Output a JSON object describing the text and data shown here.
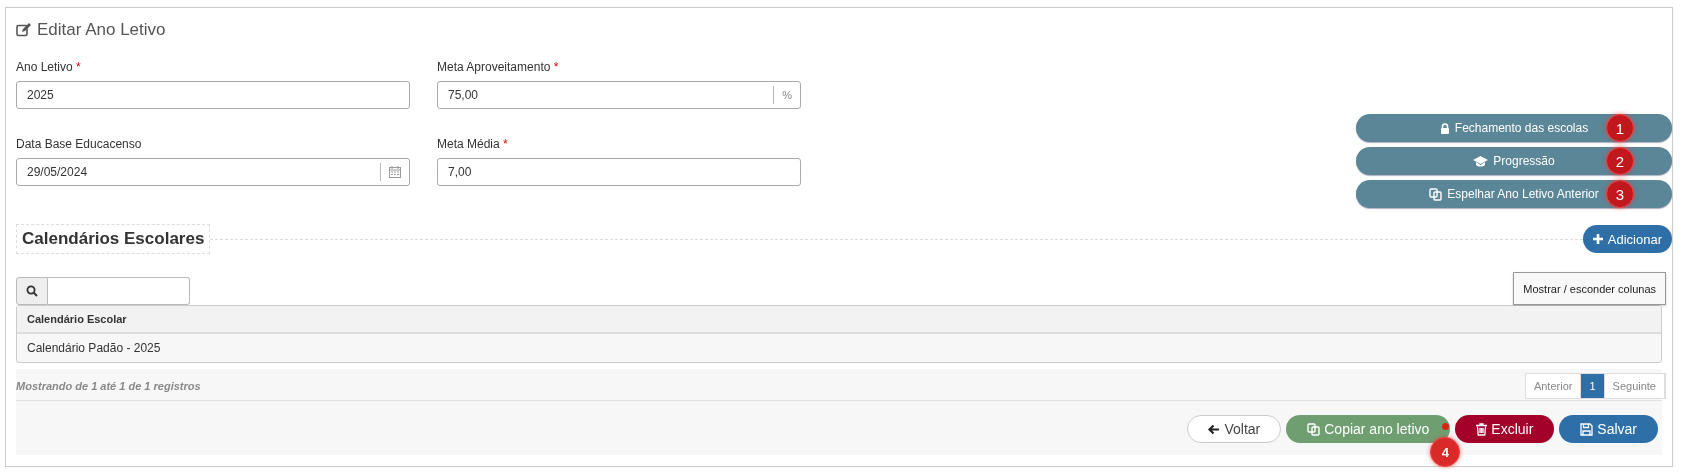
{
  "panel": {
    "title": "Editar Ano Letivo"
  },
  "fields": [
    {
      "label": "Ano Letivo",
      "required_mark": "*",
      "value": "2025",
      "kind": "text"
    },
    {
      "label": "Meta Aproveitamento",
      "required_mark": "*",
      "value": "75,00",
      "kind": "percent",
      "addon": "%"
    },
    {
      "label": "Data Base Educacenso",
      "value": "29/05/2024",
      "kind": "date"
    },
    {
      "label": "Meta Média",
      "required_mark": "*",
      "value": "7,00",
      "kind": "text"
    }
  ],
  "side_buttons": [
    {
      "label": "Fechamento das escolas",
      "kind": "closing",
      "badge": "1"
    },
    {
      "label": "Progressão",
      "kind": "progression",
      "badge": "2"
    },
    {
      "label": "Espelhar Ano Letivo Anterior",
      "kind": "mirror",
      "badge": "3"
    }
  ],
  "section": {
    "title": "Calendários Escolares",
    "add_button": "Adicionar"
  },
  "table": {
    "toggle_columns": "Mostrar / esconder colunas",
    "columns": [
      "Calendário Escolar"
    ],
    "rows": [
      [
        "Calendário Padão - 2025"
      ]
    ],
    "info": "Mostrando de 1 até 1 de 1 registros",
    "pages": [
      {
        "label": "Anterior",
        "selected": false
      },
      {
        "label": "1",
        "selected": true
      },
      {
        "label": "Seguinte",
        "selected": false
      }
    ]
  },
  "actions": [
    {
      "label": "Voltar",
      "kind": "back"
    },
    {
      "label": "Copiar ano letivo",
      "kind": "copy",
      "badge": "4"
    },
    {
      "label": "Excluir",
      "kind": "delete"
    },
    {
      "label": "Salvar",
      "kind": "save"
    }
  ]
}
